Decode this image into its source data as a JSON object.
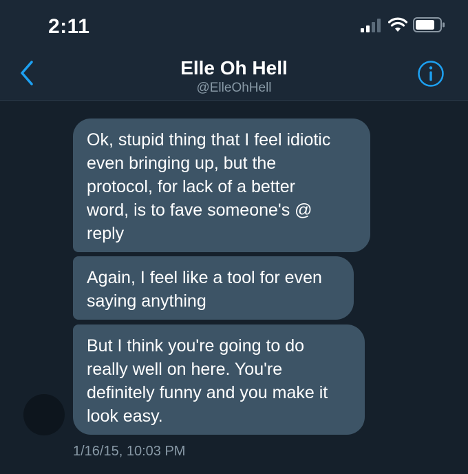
{
  "status_bar": {
    "time": "2:11"
  },
  "header": {
    "contact_name": "Elle Oh Hell",
    "contact_handle": "@ElleOhHell"
  },
  "messages": [
    {
      "text": "Ok, stupid thing that I feel idiotic\neven bringing up, but the\nprotocol, for lack of a better\nword, is to fave someone's @\nreply"
    },
    {
      "text": "Again, I feel like a tool for even\nsaying anything"
    },
    {
      "text": "But I think you're going to do\nreally well on here. You're\ndefinitely funny and you make it\nlook easy."
    }
  ],
  "timestamp": "1/16/15, 10:03 PM",
  "colors": {
    "background": "#15202b",
    "header_background": "#1b2836",
    "bubble": "#3d5466",
    "accent": "#1da1f2",
    "muted_text": "#8899a6"
  },
  "icons": {
    "back": "chevron-left-icon",
    "info": "info-icon",
    "signal": "cellular-signal-icon",
    "wifi": "wifi-icon",
    "battery": "battery-icon"
  }
}
